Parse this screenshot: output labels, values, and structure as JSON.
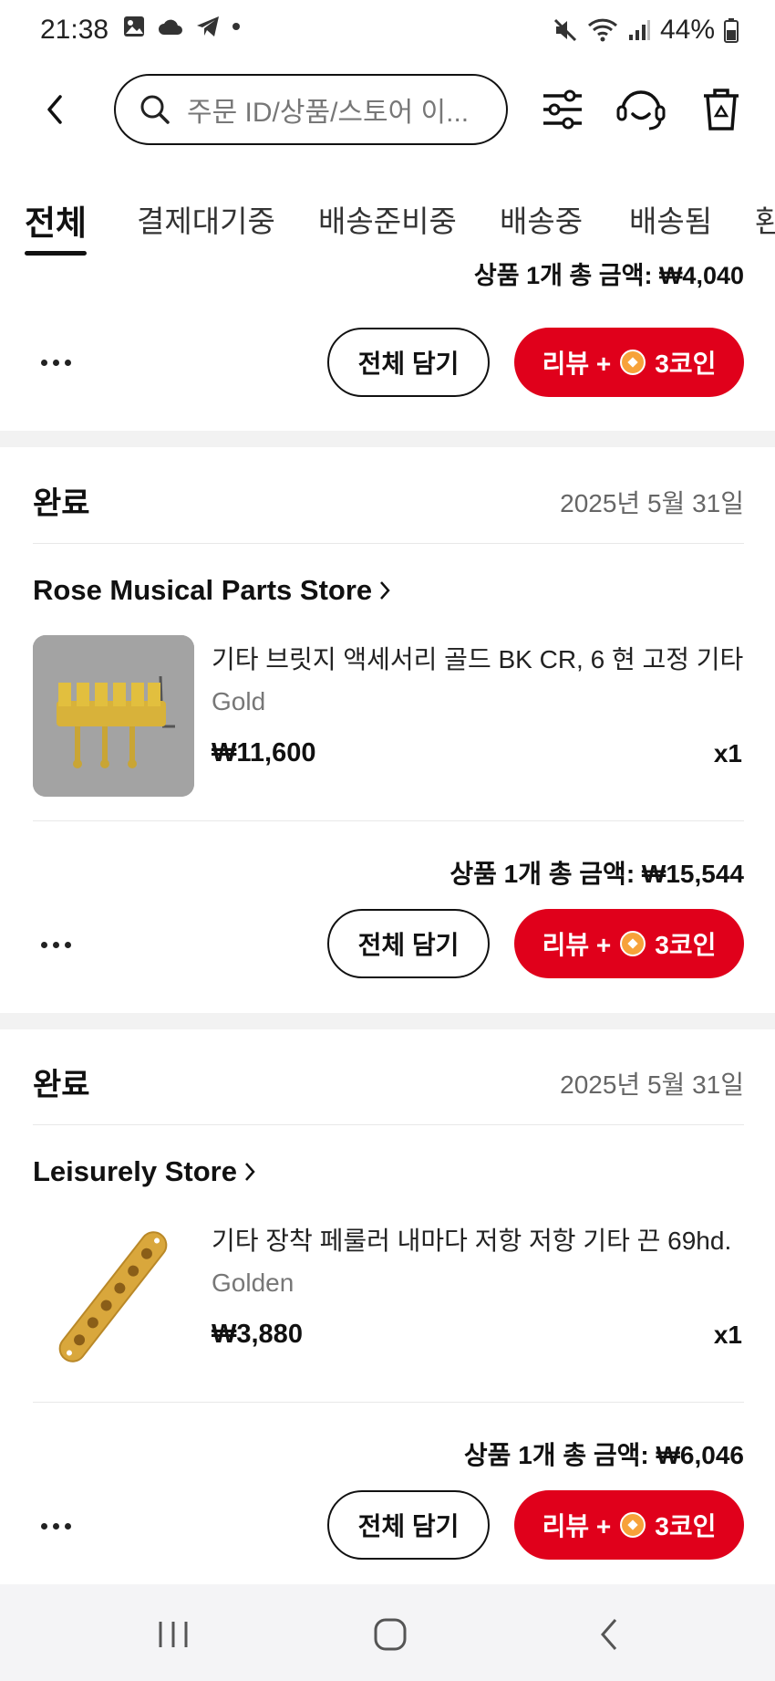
{
  "status_bar": {
    "time": "21:38",
    "battery": "44%"
  },
  "search": {
    "placeholder": "주문 ID/상품/스토어 이..."
  },
  "tabs": [
    {
      "label": "전체",
      "active": true
    },
    {
      "label": "결제대기중",
      "active": false
    },
    {
      "label": "배송준비중",
      "active": false
    },
    {
      "label": "배송중",
      "active": false
    },
    {
      "label": "배송됨",
      "active": false
    },
    {
      "label": "환",
      "active": false
    }
  ],
  "partial_order": {
    "total": "상품 1개 총 금액: ₩4,040",
    "add_all_label": "전체 담기",
    "review_label": "리뷰 +",
    "coin_label": "3코인"
  },
  "orders": [
    {
      "status": "완료",
      "date": "2025년 5월 31일",
      "store": "Rose Musical Parts Store",
      "product_title": "기타 브릿지 액세서리 골드 BK CR, 6 현 고정 기타",
      "variant": "Gold",
      "price": "₩11,600",
      "qty": "x1",
      "total": "상품 1개 총 금액: ₩15,544",
      "add_all_label": "전체 담기",
      "review_label": "리뷰 +",
      "coin_label": "3코인"
    },
    {
      "status": "완료",
      "date": "2025년 5월 31일",
      "store": "Leisurely Store",
      "product_title": "기타 장착 페룰러 내마다 저항 저항 기타 끈 69hd.",
      "variant": "Golden",
      "price": "₩3,880",
      "qty": "x1",
      "total": "상품 1개 총 금액: ₩6,046",
      "add_all_label": "전체 담기",
      "review_label": "리뷰 +",
      "coin_label": "3코인"
    }
  ],
  "colors": {
    "accent_red": "#e0001b",
    "coin": "#f7a23a"
  }
}
